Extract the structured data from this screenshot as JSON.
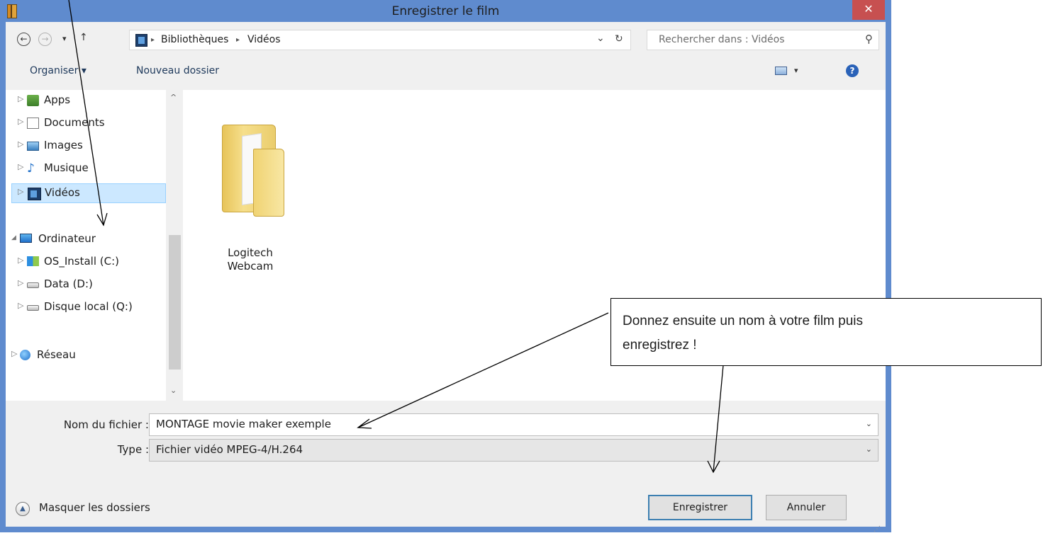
{
  "window": {
    "title": "Enregistrer le film",
    "close_glyph": "✕"
  },
  "nav": {
    "back_glyph": "←",
    "forward_glyph": "→",
    "recent_glyph": "▾",
    "up_glyph": "↑",
    "breadcrumb": [
      "Bibliothèques",
      "Vidéos"
    ],
    "separator": "▸",
    "dropdown_glyph": "⌄",
    "refresh_glyph": "↻",
    "search_placeholder": "Rechercher dans : Vidéos",
    "search_glyph": "⚲"
  },
  "toolbar": {
    "organize_label": "Organiser ▾",
    "new_folder_label": "Nouveau dossier",
    "view_dropdown_glyph": "▾",
    "help_glyph": "?"
  },
  "tree": {
    "items": [
      {
        "label": "Apps",
        "icon": "apps-icon",
        "expander": "▷"
      },
      {
        "label": "Documents",
        "icon": "documents-icon",
        "expander": "▷"
      },
      {
        "label": "Images",
        "icon": "images-icon",
        "expander": "▷"
      },
      {
        "label": "Musique",
        "icon": "music-icon",
        "expander": "▷"
      },
      {
        "label": "Vidéos",
        "icon": "videos-icon",
        "expander": "▷"
      },
      {
        "label": "Ordinateur",
        "icon": "computer-icon",
        "expander": "◢"
      },
      {
        "label": "OS_Install (C:)",
        "icon": "os-drive-icon",
        "expander": "▷"
      },
      {
        "label": "Data (D:)",
        "icon": "drive-icon",
        "expander": "▷"
      },
      {
        "label": "Disque local (Q:)",
        "icon": "drive-icon",
        "expander": "▷"
      },
      {
        "label": "Réseau",
        "icon": "network-icon",
        "expander": "▷"
      }
    ],
    "scroll_up_glyph": "^",
    "scroll_down_glyph": "⌄"
  },
  "content": {
    "folder": {
      "label_line1": "Logitech",
      "label_line2": "Webcam"
    }
  },
  "form": {
    "filename_label": "Nom du fichier :",
    "filename_value": "MONTAGE movie maker exemple",
    "type_label": "Type :",
    "type_value": "Fichier vidéo MPEG-4/H.264",
    "dropdown_glyph": "⌄"
  },
  "buttons": {
    "save": "Enregistrer",
    "cancel": "Annuler",
    "hide_folders": "Masquer les dossiers",
    "hide_folders_glyph": "▲",
    "grip_glyph": "⋰"
  },
  "annotation": {
    "text_line1": "Donnez ensuite un nom à votre film puis",
    "text_line2": "enregistrez !"
  },
  "colors": {
    "frame": "#5f8bce",
    "close": "#c75050",
    "selection": "#cce8ff",
    "primary_border": "#3c7fb1"
  }
}
